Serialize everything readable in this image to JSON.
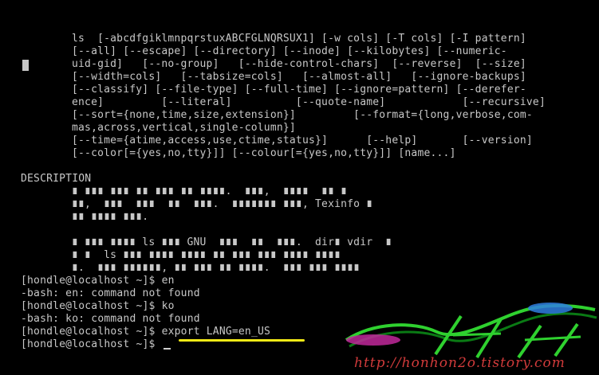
{
  "terminal": {
    "synopsis_lines": [
      "ls  [-abcdfgiklmnpqrstuxABCFGLNQRSUX1] [-w cols] [-T cols] [-I pattern]",
      "[--all] [--escape] [--directory] [--inode] [--kilobytes] [--numeric-",
      "uid-gid]   [--no-group]   [--hide-control-chars]  [--reverse]  [--size]",
      "[--width=cols]   [--tabsize=cols]   [--almost-all]   [--ignore-backups]",
      "[--classify] [--file-type] [--full-time] [--ignore=pattern] [--derefer-",
      "ence]         [--literal]          [--quote-name]            [--recursive]",
      "[--sort={none,time,size,extension}]         [--format={long,verbose,com-",
      "mas,across,vertical,single-column}]",
      "[--time={atime,access,use,ctime,status}]      [--help]       [--version]",
      "[--color[={yes,no,tty}]] [--colour[={yes,no,tty}]] [name...]"
    ],
    "description_heading": "DESCRIPTION",
    "description_lines": [
      "∎ ∎∎∎ ∎∎∎ ∎∎ ∎∎∎ ∎∎ ∎∎∎∎.  ∎∎∎,  ∎∎∎∎  ∎∎ ∎",
      "∎∎,  ∎∎∎  ∎∎∎  ∎∎  ∎∎∎.  ∎∎∎∎∎∎∎ ∎∎∎, Texinfo ∎",
      "∎∎ ∎∎∎∎ ∎∎∎.",
      "",
      "∎ ∎∎∎ ∎∎∎∎ ls ∎∎∎ GNU  ∎∎∎  ∎∎  ∎∎∎.  dir∎ vdir  ∎",
      "∎ ∎  ls ∎∎∎ ∎∎∎∎ ∎∎∎∎ ∎∎ ∎∎∎ ∎∎∎ ∎∎∎∎ ∎∎∎∎",
      "∎.  ∎∎∎ ∎∎∎∎∎∎, ∎∎ ∎∎∎ ∎∎ ∎∎∎∎.  ∎∎∎ ∎∎∎ ∎∎∎∎"
    ],
    "session_lines": [
      "[hondle@localhost ~]$ en",
      "-bash: en: command not found",
      "[hondle@localhost ~]$ ko",
      "-bash: ko: command not found",
      "[hondle@localhost ~]$ export LANG=en_US",
      "[hondle@localhost ~]$ "
    ]
  },
  "watermark": {
    "url": "http://honhon2o.tistory.com",
    "colors": {
      "green": "#2fd12f",
      "dark_green": "#0a7a14",
      "magenta": "#c0289a",
      "blue": "#2f7fe0",
      "red": "#d23b3b"
    }
  },
  "colors": {
    "background": "#000000",
    "text": "#c8c8c8",
    "underline": "#f5ea16"
  }
}
